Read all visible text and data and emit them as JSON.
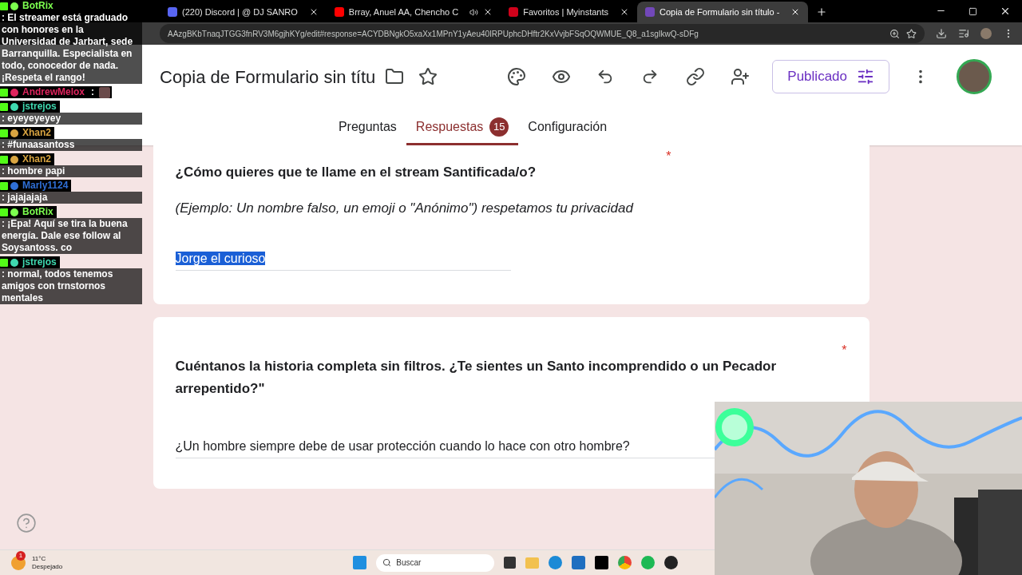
{
  "browser": {
    "tabs": [
      {
        "title": "(220) Discord | @ DJ SANRO",
        "kind": "discord",
        "audio": false,
        "selected": false
      },
      {
        "title": "Brray, Anuel AA, Chencho C",
        "kind": "youtube",
        "audio": true,
        "selected": false
      },
      {
        "title": "Favoritos | Myinstants",
        "kind": "myinstants",
        "audio": false,
        "selected": false
      },
      {
        "title": "Copia de Formulario sin título -",
        "kind": "forms",
        "audio": false,
        "selected": true
      }
    ],
    "url": "AAzgBKbTnaqJTGG3fnRV3M6gjhKYg/edit#response=ACYDBNgkO5xaXx1MPnY1yAeu40IRPUphcDHftr2KxVvjbFSqOQWMUE_Q8_a1sgIkwQ-sDFg"
  },
  "chat": [
    {
      "user": "BotRix",
      "color": "#7dff4f",
      "kind": "text",
      "text": ": El streamer está graduado con honores en la Universidad de Jarbart, sede Barranquilla. Especialista en todo, conocedor de nada. ¡Respeta el rango!"
    },
    {
      "user": "AndrewMelox",
      "color": "#e0245e",
      "kind": "emote",
      "text": ":"
    },
    {
      "user": "jstrejos",
      "color": "#3fd9b0",
      "kind": "text",
      "text": ": eyeyeyeyey"
    },
    {
      "user": "Xhan2",
      "color": "#d9a441",
      "kind": "text",
      "text": ": #funaasantoss"
    },
    {
      "user": "Xhan2",
      "color": "#d9a441",
      "kind": "text",
      "text": ": hombre papi"
    },
    {
      "user": "Marly1124",
      "color": "#2f6fd6",
      "kind": "text",
      "text": ": jajajajaja"
    },
    {
      "user": "BotRix",
      "color": "#7dff4f",
      "kind": "text",
      "text": ": ¡Epa! Aquí se tira la buena energía. Dale ese follow al Soysantoss. co"
    },
    {
      "user": "jstrejos",
      "color": "#3fd9b0",
      "kind": "text",
      "text": ": normal, todos tenemos amigos con trnstornos mentales"
    }
  ],
  "form": {
    "title": "Copia de Formulario sin títu",
    "publish_button": "Publicado",
    "tabs": [
      {
        "label": "Preguntas",
        "selected": false
      },
      {
        "label": "Respuestas",
        "badge": "15",
        "selected": true
      },
      {
        "label": "Configuración",
        "selected": false
      }
    ],
    "questions": [
      {
        "title": "¿Cómo quieres que te llame en el stream Santificada/o?",
        "description": "(Ejemplo: Un nombre falso, un emoji o \"Anónimo\") respetamos tu privacidad",
        "answer": "Jorge el curioso",
        "highlighted": true,
        "required_mark": "*"
      },
      {
        "title": "Cuéntanos la historia completa sin filtros. ¿Te sientes un Santo incomprendido o un Pecador arrepentido?\"",
        "answer": "¿Un hombre siempre debe de usar protección cuando lo hace con otro hombre?",
        "highlighted": false,
        "required_mark": "*"
      }
    ]
  },
  "taskbar": {
    "weather": {
      "temperature": "11°C",
      "condition": "Despejado",
      "badge": "1"
    },
    "search_placeholder": "Buscar"
  }
}
